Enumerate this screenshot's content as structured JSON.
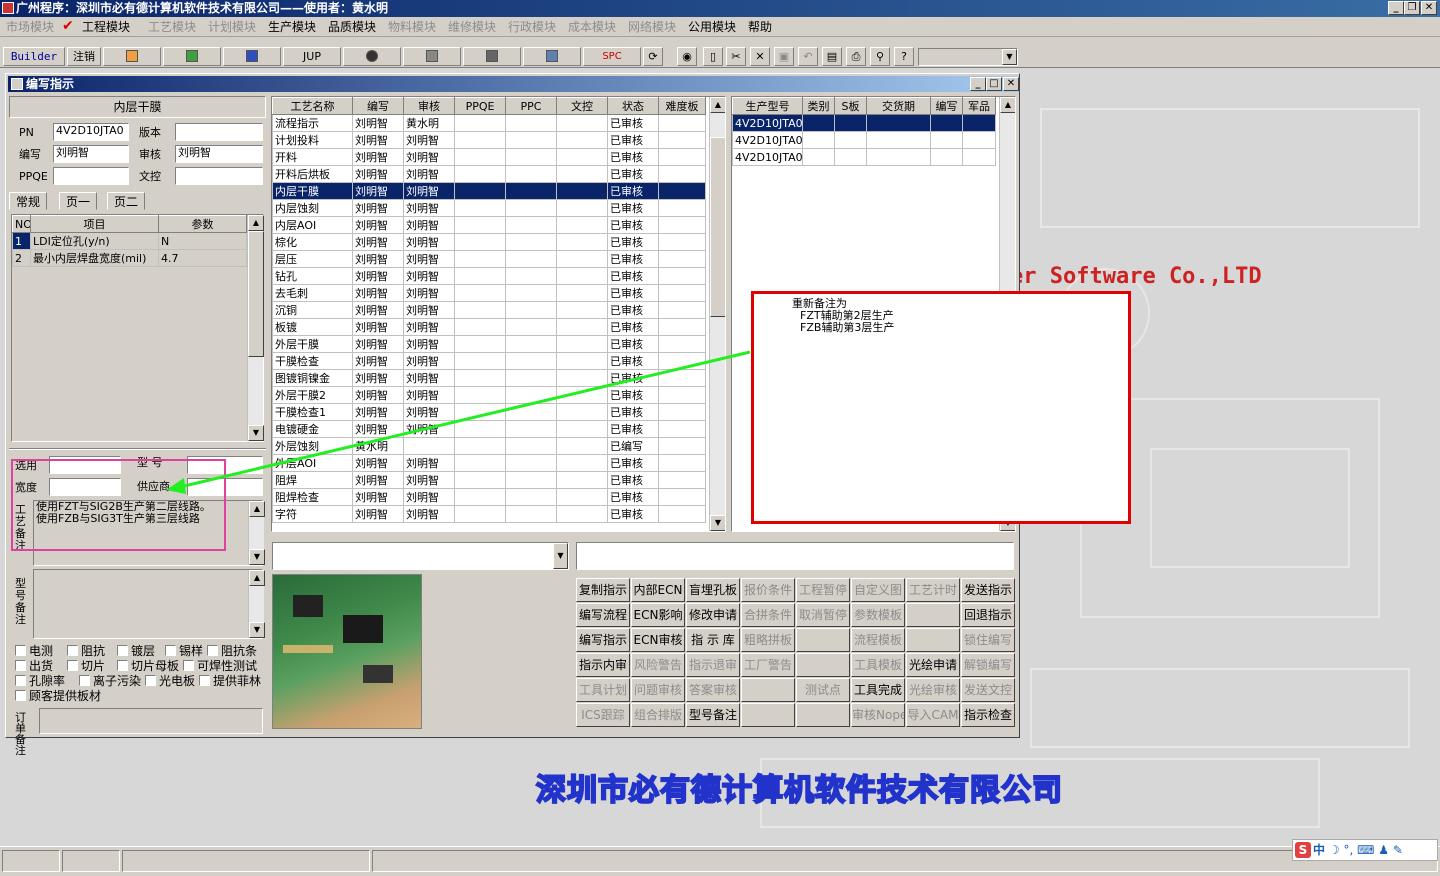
{
  "app": {
    "title": "广州程序：深圳市必有德计算机软件技术有限公司——使用者：黄水明",
    "company_footer": "深圳市必有德计算机软件技术有限公司",
    "bg_text": "er Software Co.,LTD"
  },
  "menu": [
    {
      "label": "市场模块",
      "enabled": false
    },
    {
      "label": "工程模块",
      "enabled": true
    },
    {
      "label": "工艺模块",
      "enabled": false
    },
    {
      "label": "计划模块",
      "enabled": false
    },
    {
      "label": "生产模块",
      "enabled": true
    },
    {
      "label": "品质模块",
      "enabled": true
    },
    {
      "label": "物料模块",
      "enabled": false
    },
    {
      "label": "维修模块",
      "enabled": false
    },
    {
      "label": "行政模块",
      "enabled": false
    },
    {
      "label": "成本模块",
      "enabled": false
    },
    {
      "label": "网络模块",
      "enabled": false
    },
    {
      "label": "公用模块",
      "enabled": true
    },
    {
      "label": "帮助",
      "enabled": true
    }
  ],
  "toolbar": {
    "builder": "Builder",
    "logout": "注销",
    "jup": "JUP",
    "spc": "SPC"
  },
  "child": {
    "title": "编写指示"
  },
  "left": {
    "section": "内层干膜",
    "labels": {
      "pn": "PN",
      "version": "版本",
      "writer": "编写",
      "reviewer": "审核",
      "ppqe": "PPQE",
      "ctrl": "文控"
    },
    "values": {
      "pn": "4V2D10JTA0",
      "version": "",
      "writer": "刘明智",
      "reviewer": "刘明智",
      "ppqe": "",
      "ctrl": ""
    },
    "tabs": [
      "常规",
      "页一",
      "页二"
    ],
    "param_headers": [
      "NO",
      "项目",
      "参数"
    ],
    "params": [
      {
        "no": "1",
        "item": "LDI定位孔(y/n)",
        "value": "N"
      },
      {
        "no": "2",
        "item": "最小内层焊盘宽度(mil)",
        "value": "4.7"
      }
    ],
    "material_labels": {
      "select": "选用",
      "model": "型  号",
      "width": "宽度",
      "supplier": "供应商"
    },
    "process_note_label": "工艺备注",
    "process_note": [
      "使用FZT与SIG2B生产第二层线路。",
      "使用FZB与SIG3T生产第三层线路"
    ],
    "model_note_label": "型号备注",
    "order_note_label": "订单备注",
    "checks": [
      [
        "电测",
        "阻抗",
        "镀层",
        "锡样",
        "阻抗条"
      ],
      [
        "出货",
        "切片",
        "切片母板",
        "可焊性测试"
      ],
      [
        "孔隙率",
        "离子污染",
        "光电板",
        "提供菲林"
      ],
      [
        "顾客提供板材"
      ]
    ]
  },
  "process": {
    "headers": [
      "工艺名称",
      "编写",
      "审核",
      "PPQE",
      "PPC",
      "文控",
      "状态",
      "难度板"
    ],
    "rows": [
      [
        "流程指示",
        "刘明智",
        "黄水明",
        "",
        "",
        "",
        "已审核",
        ""
      ],
      [
        "计划投料",
        "刘明智",
        "刘明智",
        "",
        "",
        "",
        "已审核",
        ""
      ],
      [
        "开料",
        "刘明智",
        "刘明智",
        "",
        "",
        "",
        "已审核",
        ""
      ],
      [
        "开料后烘板",
        "刘明智",
        "刘明智",
        "",
        "",
        "",
        "已审核",
        ""
      ],
      [
        "内层干膜",
        "刘明智",
        "刘明智",
        "",
        "",
        "",
        "已审核",
        ""
      ],
      [
        "内层蚀刻",
        "刘明智",
        "刘明智",
        "",
        "",
        "",
        "已审核",
        ""
      ],
      [
        "内层AOI",
        "刘明智",
        "刘明智",
        "",
        "",
        "",
        "已审核",
        ""
      ],
      [
        "棕化",
        "刘明智",
        "刘明智",
        "",
        "",
        "",
        "已审核",
        ""
      ],
      [
        "层压",
        "刘明智",
        "刘明智",
        "",
        "",
        "",
        "已审核",
        ""
      ],
      [
        "钻孔",
        "刘明智",
        "刘明智",
        "",
        "",
        "",
        "已审核",
        ""
      ],
      [
        "去毛刺",
        "刘明智",
        "刘明智",
        "",
        "",
        "",
        "已审核",
        ""
      ],
      [
        "沉铜",
        "刘明智",
        "刘明智",
        "",
        "",
        "",
        "已审核",
        ""
      ],
      [
        "板镀",
        "刘明智",
        "刘明智",
        "",
        "",
        "",
        "已审核",
        ""
      ],
      [
        "外层干膜",
        "刘明智",
        "刘明智",
        "",
        "",
        "",
        "已审核",
        ""
      ],
      [
        "干膜检查",
        "刘明智",
        "刘明智",
        "",
        "",
        "",
        "已审核",
        ""
      ],
      [
        "图镀铜镍金",
        "刘明智",
        "刘明智",
        "",
        "",
        "",
        "已审核",
        ""
      ],
      [
        "外层干膜2",
        "刘明智",
        "刘明智",
        "",
        "",
        "",
        "已审核",
        ""
      ],
      [
        "干膜检查1",
        "刘明智",
        "刘明智",
        "",
        "",
        "",
        "已审核",
        ""
      ],
      [
        "电镀硬金",
        "刘明智",
        "刘明智",
        "",
        "",
        "",
        "已审核",
        ""
      ],
      [
        "外层蚀刻",
        "黄水明",
        "",
        "",
        "",
        "",
        "已编写",
        ""
      ],
      [
        "外层AOI",
        "刘明智",
        "刘明智",
        "",
        "",
        "",
        "已审核",
        ""
      ],
      [
        "阻焊",
        "刘明智",
        "刘明智",
        "",
        "",
        "",
        "已审核",
        ""
      ],
      [
        "阻焊检查",
        "刘明智",
        "刘明智",
        "",
        "",
        "",
        "已审核",
        ""
      ],
      [
        "字符",
        "刘明智",
        "刘明智",
        "",
        "",
        "",
        "已审核",
        ""
      ]
    ],
    "selected_index": 4
  },
  "production": {
    "headers": [
      "生产型号",
      "类别",
      "S板",
      "交货期",
      "编写",
      "军品"
    ],
    "rows": [
      [
        "4V2D10JTA0",
        "",
        "",
        "",
        "",
        ""
      ],
      [
        "4V2D10JTA0",
        "",
        "",
        "",
        "",
        ""
      ],
      [
        "4V2D10JTA0",
        "",
        "",
        "",
        "",
        ""
      ]
    ],
    "selected_index": 0
  },
  "annotation": {
    "title": "重新备注为",
    "lines": [
      "FZT辅助第2层生产",
      "FZB辅助第3层生产"
    ],
    "box_color": "#e00000",
    "arrow_color": "#22ee22",
    "highlight_color": "#e040a0"
  },
  "buttons": [
    [
      {
        "l": "复制指示",
        "e": true
      },
      {
        "l": "内部ECN",
        "e": true
      },
      {
        "l": "盲埋孔板",
        "e": true
      },
      {
        "l": "报价条件",
        "e": false
      },
      {
        "l": "工程暂停",
        "e": false
      },
      {
        "l": "自定义图",
        "e": false
      },
      {
        "l": "工艺计时",
        "e": false
      },
      {
        "l": "发送指示",
        "e": true
      }
    ],
    [
      {
        "l": "编写流程",
        "e": true
      },
      {
        "l": "ECN影响",
        "e": true
      },
      {
        "l": "修改申请",
        "e": true
      },
      {
        "l": "合拼条件",
        "e": false
      },
      {
        "l": "取消暂停",
        "e": false
      },
      {
        "l": "参数模板",
        "e": false
      },
      {
        "l": "",
        "e": false
      },
      {
        "l": "回退指示",
        "e": true
      }
    ],
    [
      {
        "l": "编写指示",
        "e": true
      },
      {
        "l": "ECN审核",
        "e": true
      },
      {
        "l": "指 示 库",
        "e": true
      },
      {
        "l": "粗略拼板",
        "e": false
      },
      {
        "l": "",
        "e": false
      },
      {
        "l": "流程模板",
        "e": false
      },
      {
        "l": "",
        "e": false
      },
      {
        "l": "锁住编写",
        "e": false
      }
    ],
    [
      {
        "l": "指示内审",
        "e": true
      },
      {
        "l": "风险警告",
        "e": false
      },
      {
        "l": "指示退审",
        "e": false
      },
      {
        "l": "工厂警告",
        "e": false
      },
      {
        "l": "",
        "e": false
      },
      {
        "l": "工具模板",
        "e": false
      },
      {
        "l": "光绘申请",
        "e": true
      },
      {
        "l": "解锁编写",
        "e": false
      }
    ],
    [
      {
        "l": "工具计划",
        "e": false
      },
      {
        "l": "问题审核",
        "e": false
      },
      {
        "l": "答案审核",
        "e": false
      },
      {
        "l": "",
        "e": false
      },
      {
        "l": "测试点",
        "e": false
      },
      {
        "l": "工具完成",
        "e": true
      },
      {
        "l": "光绘审核",
        "e": false
      },
      {
        "l": "发送文控",
        "e": false
      }
    ],
    [
      {
        "l": "ICS跟踪",
        "e": false
      },
      {
        "l": "组合排版",
        "e": false
      },
      {
        "l": "型号备注",
        "e": true
      },
      {
        "l": "",
        "e": false
      },
      {
        "l": "",
        "e": false
      },
      {
        "l": "审核Nope",
        "e": false
      },
      {
        "l": "导入CAM",
        "e": false
      },
      {
        "l": "指示检查",
        "e": true
      }
    ]
  ],
  "tray": {
    "ime": "中"
  }
}
